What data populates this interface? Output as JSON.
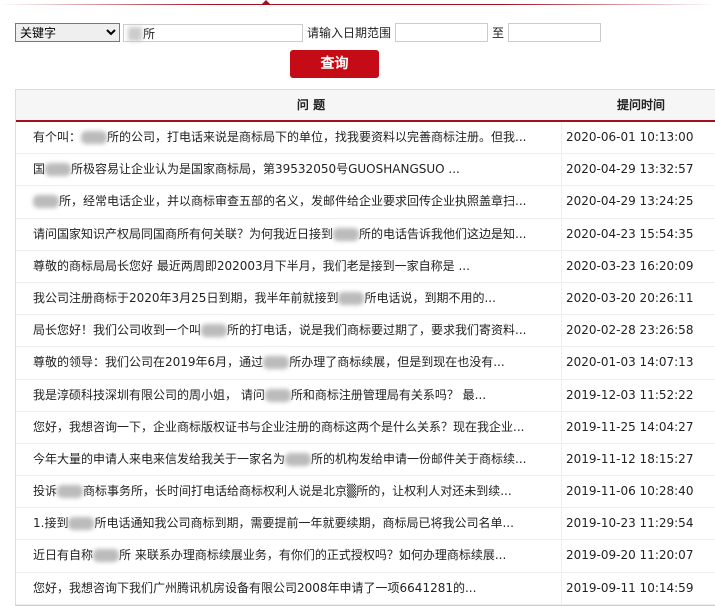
{
  "search": {
    "field_select": "关键字",
    "keyword_value_visible": "所",
    "date_label": "请输入日期范围",
    "to_label": "至",
    "date_from": "",
    "date_to": "",
    "submit": "查询"
  },
  "table": {
    "headers": {
      "question": "问 题",
      "time": "提问时间"
    },
    "rows": [
      {
        "pre": "有个叫：",
        "post": "所的公司，打电话来说是商标局下的单位，找我要资料以完善商标注册。但我...",
        "time": "2020-06-01 10:13:00"
      },
      {
        "pre": "国",
        "post": "所极容易让企业认为是国家商标局，第39532050号GUOSHANGSUO ...",
        "time": "2020-04-29 13:32:57"
      },
      {
        "pre": "",
        "post": "所，经常电话企业，并以商标审查五部的名义，发邮件给企业要求回传企业执照盖章扫...",
        "time": "2020-04-29 13:24:25"
      },
      {
        "pre": "请问国家知识产权局同国商所有何关联？为何我近日接到",
        "post": "所的电话告诉我他们这边是知...",
        "time": "2020-04-23 15:54:35"
      },
      {
        "pre": "尊敬的商标局局长您好 最近两周即202003月下半月，我们老是接到一家自称是 ...",
        "post": "",
        "time": "2020-03-23 16:20:09"
      },
      {
        "pre": "我公司注册商标于2020年3月25日到期，我半年前就接到",
        "post": "所电话说，到期不用的...",
        "time": "2020-03-20 20:26:11"
      },
      {
        "pre": "局长您好！我们公司收到一个叫",
        "post": "所的打电话，说是我们商标要过期了，要求我们寄资料...",
        "time": "2020-02-28 23:26:58"
      },
      {
        "pre": "尊敬的领导：我们公司在2019年6月，通过",
        "post": "所办理了商标续展，但是到现在也没有...",
        "time": "2020-01-03 14:07:13"
      },
      {
        "pre": "我是淳硕科技深圳有限公司的周小姐， 请问",
        "post": "所和商标注册管理局有关系吗？ 最...",
        "time": "2019-12-03 11:52:22"
      },
      {
        "pre": "您好，我想咨询一下，企业商标版权证书与企业注册的商标这两个是什么关系？现在我企业...",
        "post": "",
        "time": "2019-11-25 14:04:27"
      },
      {
        "pre": "今年大量的申请人来电来信发给我关于一家名为",
        "post": "所的机构发给申请一份邮件关于商标续...",
        "time": "2019-11-12 18:15:27"
      },
      {
        "pre": "投诉",
        "post": "商标事务所，长时间打电话给商标权利人说是北京▒所的，让权利人对还未到续...",
        "time": "2019-11-06 10:28:40"
      },
      {
        "pre": "1.接到",
        "post": "所电话通知我公司商标到期，需要提前一年就要续期，商标局已将我公司名单...",
        "time": "2019-10-23 11:29:54"
      },
      {
        "pre": "近日有自称",
        "post": "所 来联系办理商标续展业务，有你们的正式授权吗？如何办理商标续展...",
        "time": "2019-09-20 11:20:07"
      },
      {
        "pre": "您好，我想咨询下我们广州腾讯机房设备有限公司2008年申请了一项6641281的...",
        "post": "",
        "time": "2019-09-11 10:14:59"
      }
    ]
  },
  "colors": {
    "accent": "#c50c16",
    "header_rule": "#a01020"
  }
}
